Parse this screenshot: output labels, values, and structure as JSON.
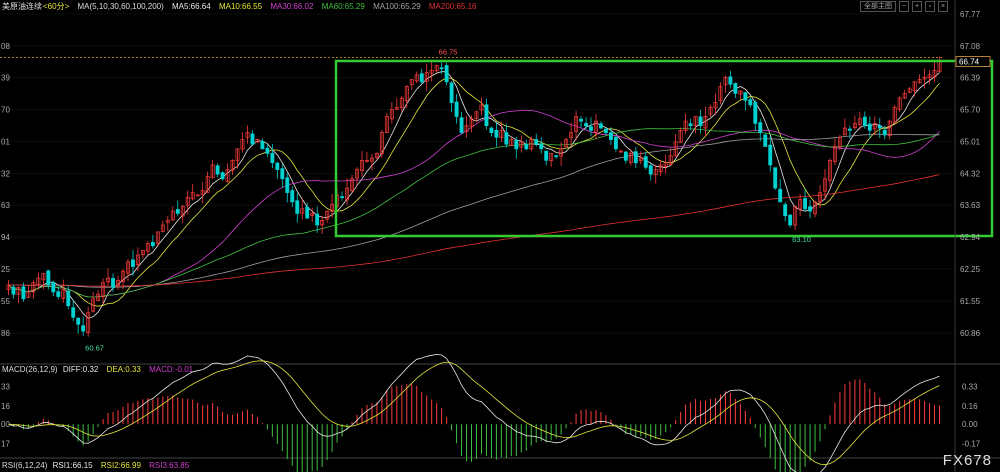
{
  "toolbar": {
    "range_label": "全部主图",
    "icons": [
      "minus-icon",
      "plus-icon",
      "window-icon",
      "close-icon"
    ]
  },
  "main_legend": {
    "title": "美原油连续",
    "period": "<60分>",
    "ma_params": "MA(5,10,30,60,100,200)",
    "items": [
      {
        "label": "MA5:66.64",
        "color": "#e8e8e8"
      },
      {
        "label": "MA10:66.55",
        "color": "#e6e63c"
      },
      {
        "label": "MA30:66.02",
        "color": "#d040d0"
      },
      {
        "label": "MA60:65.29",
        "color": "#40c040"
      },
      {
        "label": "MA100:65.29",
        "color": "#a0a0a0"
      },
      {
        "label": "MA200:65.16",
        "color": "#e03030"
      }
    ]
  },
  "macd_legend": {
    "params": "MACD(26,12,9)",
    "items": [
      {
        "label": "DIFF:0.32",
        "color": "#e8e8e8"
      },
      {
        "label": "DEA:0.33",
        "color": "#e6e63c"
      },
      {
        "label": "MACD:-0.01",
        "color": "#d040d0"
      }
    ]
  },
  "rsi_legend": {
    "params": "RSI(6,12,24)",
    "items": [
      {
        "label": "RSI1:66.15",
        "color": "#e8e8e8"
      },
      {
        "label": "RSI2:66.99",
        "color": "#e6e63c"
      },
      {
        "label": "RSI3:63.85",
        "color": "#d040d0"
      }
    ]
  },
  "right_axis_ticks": [
    "67.77",
    "67.08",
    "66.39",
    "65.70",
    "65.01",
    "64.32",
    "63.63",
    "62.94",
    "62.25",
    "61.55",
    "60.86"
  ],
  "left_axis_ticks": [
    "08",
    "39",
    "70",
    "01",
    "32",
    "63",
    "94",
    "25",
    "55",
    "86"
  ],
  "macd_right_ticks": [
    "0.33",
    "0.16",
    "0.00",
    "-0.17"
  ],
  "macd_left_ticks": [
    "33",
    "16",
    "00",
    "17"
  ],
  "annotations": {
    "high": "66.75",
    "low": "63.10",
    "start_low": "60.67",
    "last_high": "67.01",
    "last_price": "66.74"
  },
  "watermark": "FX678",
  "colors": {
    "up": "#ff3c3c",
    "down": "#00d2d2",
    "box": "#33cc33",
    "dash": "#e0a040"
  },
  "chart_data": {
    "type": "candlestick",
    "symbol": "美原油连续",
    "interval": "60分",
    "ylim": [
      60.86,
      67.77
    ],
    "annotated_points": [
      {
        "label": "60.67",
        "type": "low"
      },
      {
        "label": "66.75",
        "type": "high"
      },
      {
        "label": "63.10",
        "type": "low"
      },
      {
        "label": "67.01",
        "type": "high"
      }
    ],
    "close_path": [
      61.9,
      61.7,
      61.85,
      61.6,
      61.75,
      61.95,
      62.05,
      62.15,
      61.9,
      61.75,
      61.65,
      61.8,
      61.45,
      61.2,
      61.05,
      60.9,
      61.3,
      61.6,
      61.7,
      61.95,
      62.05,
      61.85,
      62.0,
      62.2,
      62.4,
      62.3,
      62.55,
      62.65,
      62.8,
      62.75,
      63.05,
      63.2,
      63.3,
      63.5,
      63.45,
      63.6,
      63.8,
      63.9,
      63.85,
      63.95,
      64.25,
      64.5,
      64.3,
      64.2,
      64.4,
      64.6,
      64.85,
      65.05,
      65.2,
      64.95,
      65.05,
      64.85,
      64.75,
      64.55,
      64.4,
      64.2,
      63.9,
      63.7,
      63.45,
      63.55,
      63.35,
      63.45,
      63.2,
      63.3,
      63.5,
      63.65,
      63.85,
      63.8,
      64.0,
      64.2,
      64.4,
      64.6,
      64.6,
      64.65,
      64.75,
      65.2,
      65.55,
      65.7,
      65.75,
      65.95,
      66.2,
      66.35,
      66.45,
      66.3,
      66.5,
      66.55,
      66.65,
      66.6,
      66.3,
      65.85,
      65.55,
      65.2,
      65.35,
      65.5,
      65.65,
      65.8,
      65.35,
      65.2,
      65.1,
      65.25,
      64.95,
      65.05,
      64.85,
      65.0,
      64.85,
      65.05,
      64.95,
      64.85,
      64.6,
      64.75,
      64.7,
      64.85,
      65.05,
      65.2,
      65.55,
      65.45,
      65.35,
      65.25,
      65.45,
      65.3,
      65.2,
      65.05,
      64.85,
      64.8,
      64.6,
      64.75,
      64.55,
      64.65,
      64.45,
      64.3,
      64.4,
      64.5,
      64.55,
      64.7,
      65.0,
      65.25,
      65.45,
      65.35,
      65.55,
      65.35,
      65.55,
      65.75,
      65.85,
      66.2,
      66.4,
      66.25,
      66.05,
      66.1,
      65.9,
      65.8,
      65.4,
      65.2,
      64.9,
      64.5,
      64.0,
      63.7,
      63.4,
      63.2,
      63.6,
      63.75,
      63.55,
      63.5,
      63.7,
      63.9,
      64.2,
      64.6,
      64.9,
      65.1,
      65.3,
      65.25,
      65.4,
      65.5,
      65.35,
      65.25,
      65.4,
      65.3,
      65.15,
      65.45,
      65.75,
      65.95,
      66.05,
      66.15,
      66.3,
      66.35,
      66.4,
      66.45,
      66.55,
      66.74
    ],
    "series_names": [
      "MA5",
      "MA10",
      "MA30",
      "MA60",
      "MA100",
      "MA200"
    ],
    "macd": {
      "diff": 0.32,
      "dea": 0.33,
      "macd": -0.01
    },
    "rsi": {
      "rsi1": 66.15,
      "rsi2": 66.99,
      "rsi3": 63.85
    }
  }
}
